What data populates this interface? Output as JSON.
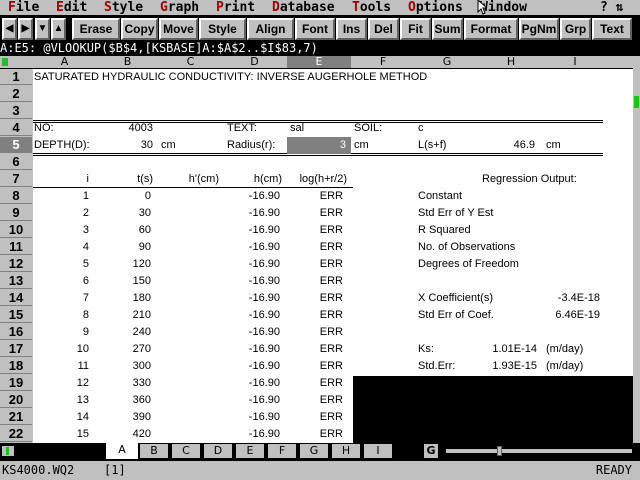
{
  "menu": [
    "File",
    "Edit",
    "Style",
    "Graph",
    "Print",
    "Database",
    "Tools",
    "Options",
    "Window"
  ],
  "menu_right": "? ⇅",
  "toolbar": {
    "arrows": [
      "◀",
      "▶",
      "▼",
      "▲"
    ],
    "buttons": [
      "Erase",
      "Copy",
      "Move",
      "Style",
      "Align",
      "Font",
      "Ins",
      "Del",
      "Fit",
      "Sum",
      "Format",
      "PgNm",
      "Grp",
      "Text"
    ]
  },
  "formula_line": "A:E5: @VLOOKUP($B$4,[KSBASE]A:$A$2..$I$83,7)",
  "columns": [
    "A",
    "B",
    "C",
    "D",
    "E",
    "F",
    "G",
    "H",
    "I"
  ],
  "rows": [
    "1",
    "2",
    "3",
    "4",
    "5",
    "6",
    "7",
    "8",
    "9",
    "10",
    "11",
    "12",
    "13",
    "14",
    "15",
    "16",
    "17",
    "18",
    "19",
    "20",
    "21",
    "22"
  ],
  "sheet": {
    "title": "SATURATED HYDRAULIC CONDUCTIVITY: INVERSE AUGERHOLE METHOD",
    "no_label": "NO:",
    "no_value": "4003",
    "text_label": "TEXT:",
    "text_value": "sal",
    "soil_label": "SOIL:",
    "soil_value": "c",
    "depth_label": "DEPTH(D):",
    "depth_value": "30",
    "depth_unit": "cm",
    "radius_label": "Radius(r):",
    "radius_value": "3",
    "radius_unit": "cm",
    "lsf_label": "L(s+f)",
    "lsf_value": "46.9",
    "lsf_unit": "cm",
    "headers": [
      "i",
      "t(s)",
      "h'(cm)",
      "h(cm)",
      "log(h+r/2)"
    ],
    "data": [
      [
        "1",
        "0",
        "",
        "-16.90",
        "ERR"
      ],
      [
        "2",
        "30",
        "",
        "-16.90",
        "ERR"
      ],
      [
        "3",
        "60",
        "",
        "-16.90",
        "ERR"
      ],
      [
        "4",
        "90",
        "",
        "-16.90",
        "ERR"
      ],
      [
        "5",
        "120",
        "",
        "-16.90",
        "ERR"
      ],
      [
        "6",
        "150",
        "",
        "-16.90",
        "ERR"
      ],
      [
        "7",
        "180",
        "",
        "-16.90",
        "ERR"
      ],
      [
        "8",
        "210",
        "",
        "-16.90",
        "ERR"
      ],
      [
        "9",
        "240",
        "",
        "-16.90",
        "ERR"
      ],
      [
        "10",
        "270",
        "",
        "-16.90",
        "ERR"
      ],
      [
        "11",
        "300",
        "",
        "-16.90",
        "ERR"
      ],
      [
        "12",
        "330",
        "",
        "-16.90",
        "ERR"
      ],
      [
        "13",
        "360",
        "",
        "-16.90",
        "ERR"
      ],
      [
        "14",
        "390",
        "",
        "-16.90",
        "ERR"
      ],
      [
        "15",
        "420",
        "",
        "-16.90",
        "ERR"
      ]
    ],
    "regression_title": "Regression Output:",
    "regression": [
      {
        "label": "Constant",
        "value": ""
      },
      {
        "label": "Std Err of Y Est",
        "value": ""
      },
      {
        "label": "R Squared",
        "value": ""
      },
      {
        "label": "No. of Observations",
        "value": ""
      },
      {
        "label": "Degrees of Freedom",
        "value": ""
      },
      {
        "label": "",
        "value": ""
      },
      {
        "label": "X Coefficient(s)",
        "value": "-3.4E-18"
      },
      {
        "label": "Std Err of Coef.",
        "value": "6.46E-19"
      }
    ],
    "ks_label": "Ks:",
    "ks_value": "1.01E-14",
    "ks_unit": "(m/day)",
    "stderr_label": "Std.Err:",
    "stderr_value": "1.93E-15",
    "stderr_unit": "(m/day)"
  },
  "sheet_tabs": [
    "A",
    "B",
    "C",
    "D",
    "E",
    "F",
    "G",
    "H",
    "I"
  ],
  "group_button": "G",
  "status": {
    "file": "KS4000.WQ2",
    "page": "[1]",
    "mode": "READY"
  },
  "colors": {
    "menu_hotkey": "#a00000",
    "chrome": "#c0c0c0",
    "selected_cell": "#808080",
    "black_block": "#000000"
  }
}
